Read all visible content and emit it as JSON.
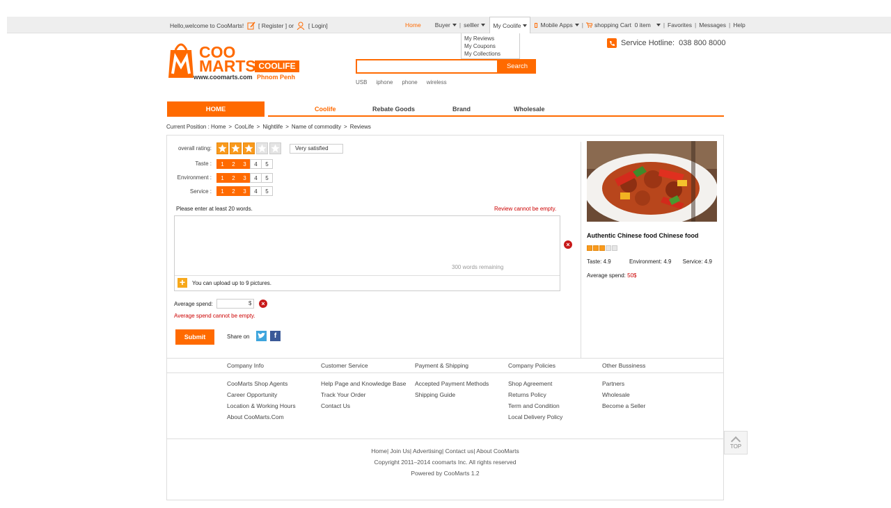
{
  "topbar": {
    "welcome": "Hello,welcome to CooMarts!",
    "register": "[ Register ]",
    "or": "or",
    "login": "[ Login]",
    "home": "Home",
    "buyer": "Buyer",
    "seller": "selller",
    "coolife": "My Coolife",
    "mobile": "Mobile Apps",
    "cart": "shopping Cart",
    "cart_count": "0 item",
    "favorites": "Favorites",
    "messages": "Messages",
    "help": "Help",
    "dropdown": [
      "My Reviews",
      "My Coupons",
      "My Collections"
    ]
  },
  "header": {
    "logo_line1": "COO",
    "logo_line2": "MARTS",
    "logo_badge": "COOLIFE",
    "logo_url": "www.coomarts.com",
    "logo_city": "Phnom Penh",
    "hotline_label": "Service Hotline:",
    "hotline_number": "038 800 8000",
    "search_button": "Search",
    "hot_words": [
      "USB",
      "iphone",
      "phone",
      "wireless"
    ]
  },
  "nav": {
    "home": "HOME",
    "items": [
      "Coolife",
      "Rebate Goods",
      "Brand",
      "Wholesale"
    ]
  },
  "breadcrumb": {
    "label": "Current Position :",
    "items": [
      "Home",
      "CooLife",
      "Nightlife",
      "Name of commodity",
      "Reviews"
    ]
  },
  "review": {
    "overall_label": "overall rating:",
    "overall_value": 3,
    "overall_tip": "Very satisfied",
    "taste_label": "Taste :",
    "environment_label": "Environment :",
    "service_label": "Service :",
    "scale": [
      "1",
      "2",
      "3",
      "4",
      "5"
    ],
    "taste_value": 3,
    "environment_value": 3,
    "service_value": 3,
    "hint": "Please enter at least 20 words.",
    "error_review": "Review cannot be empty.",
    "remaining": "300 words remaining",
    "upload_text": "You can upload up to 9 pictures.",
    "spend_label": "Average spend:",
    "spend_unit": "$",
    "error_spend": "Average spend cannot be empty.",
    "submit": "Submit",
    "share_label": "Share on"
  },
  "product": {
    "title": "Authentic Chinese food Chinese food",
    "stars": 3,
    "taste_label": "Taste:",
    "taste": "4.9",
    "env_label": "Environment:",
    "env": "4.9",
    "service_label": "Service:",
    "service": "4.9",
    "spend_label": "Average spend:",
    "spend": "50$"
  },
  "footer": {
    "cols": [
      {
        "title": "Company Info",
        "links": [
          "CooMarts Shop Agents",
          "Career Opportunity",
          "Location & Working Hours",
          "About CooMarts.Com"
        ]
      },
      {
        "title": "Customer Service",
        "links": [
          "Help Page and Knowledge Base",
          "Track Your Order",
          "Contact Us"
        ]
      },
      {
        "title": "Payment & Shipping",
        "links": [
          "Accepted Payment Methods",
          "Shipping Guide"
        ]
      },
      {
        "title": "Company Policies",
        "links": [
          "Shop Agreement",
          "Returns Policy",
          "Term and Condition",
          "Local Delivery Policy"
        ]
      },
      {
        "title": "Other Bussiness",
        "links": [
          "Partners",
          "Wholesale",
          "Become a Seller"
        ]
      }
    ],
    "bottom_links": "Home| Join Us| Advertising| Contact us| About CooMarts",
    "copyright": "Copyright 2011–2014 coomarts Inc. All rights reserved",
    "powered": "Powered by CooMarts 1.2",
    "top_label": "TOP"
  },
  "colors": {
    "accent": "#ff6a00",
    "error": "#cc0000",
    "star": "#f99a1d"
  }
}
